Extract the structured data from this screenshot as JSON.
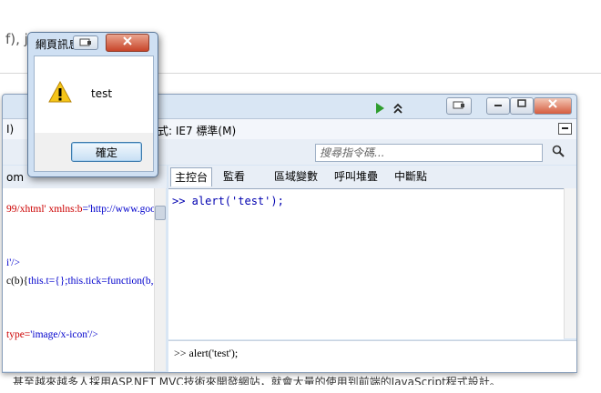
{
  "background": {
    "top_text": "f), j",
    "bottom_text": "甚至越來越多人採用ASP.NET MVC技術來開發網站，就會大量的使用到前端的JavaScript程式設計。"
  },
  "devtools": {
    "menu_left": "I)",
    "document_mode": "式: IE7 標準(M)",
    "search_placeholder": "搜尋指令碼...",
    "left_tab": "om",
    "script_lines": [
      {
        "text": "99/xhtml' ",
        "attr": "xmlns:b",
        "value": "='http://www.goog"
      },
      {
        "text": "i'/>",
        "attr": "",
        "value": ""
      },
      {
        "text": "c(b){",
        "attr": "",
        "value": "this.t={};this.tick=function(b,i,c"
      },
      {
        "text": "type=",
        "attr": "",
        "value": "'image/x-icon'/>"
      }
    ],
    "tabs": {
      "console": "主控台",
      "watch": "監看",
      "locals": "區域變數",
      "callstack": "呼叫堆疊",
      "breakpoints": "中斷點"
    },
    "console_output": ">> alert('test');",
    "console_input": ">> alert('test');"
  },
  "alert": {
    "title": "網頁訊息",
    "message": "test",
    "ok_label": "確定"
  },
  "colors": {
    "code_attr": "#cc0000",
    "code_value": "#0000cc",
    "console_text": "#0000b0",
    "run_green": "#2e9d2e"
  }
}
